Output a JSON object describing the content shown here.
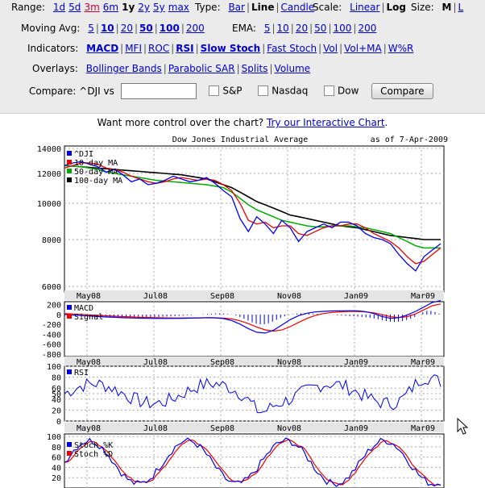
{
  "controls": {
    "range": {
      "label": "Range:",
      "options": [
        "1d",
        "5d",
        "3m",
        "6m",
        "1y",
        "2y",
        "5y",
        "max"
      ],
      "current": "1y",
      "highlight": "3m"
    },
    "type": {
      "label": "Type:",
      "options": [
        "Bar",
        "Line",
        "Candle"
      ],
      "current": "Line"
    },
    "scale": {
      "label": "Scale:",
      "options": [
        "Linear",
        "Log"
      ],
      "current": "Log"
    },
    "size": {
      "label": "Size:",
      "options": [
        "M",
        "L"
      ],
      "current": "M"
    },
    "moving_avg": {
      "label": "Moving Avg:",
      "options": [
        "5",
        "10",
        "20",
        "50",
        "100",
        "200"
      ],
      "bold": [
        "10",
        "50",
        "100"
      ]
    },
    "ema": {
      "label": "EMA:",
      "options": [
        "5",
        "10",
        "20",
        "50",
        "100",
        "200"
      ]
    },
    "indicators": {
      "label": "Indicators:",
      "options": [
        "MACD",
        "MFI",
        "ROC",
        "RSI",
        "Slow Stoch",
        "Fast Stoch",
        "Vol",
        "Vol+MA",
        "W%R"
      ],
      "bold": [
        "MACD",
        "RSI",
        "Slow Stoch"
      ]
    },
    "overlays": {
      "label": "Overlays:",
      "options": [
        "Bollinger Bands",
        "Parabolic SAR",
        "Splits",
        "Volume"
      ]
    },
    "compare": {
      "label": "Compare: ^DJI vs",
      "input_value": "",
      "checkboxes": [
        "S&P",
        "Nasdaq",
        "Dow"
      ],
      "button": "Compare"
    }
  },
  "promo": {
    "text": "Want more control over the chart?",
    "link": "Try our Interactive Chart",
    "suffix": "."
  },
  "chart_data": {
    "type": "line",
    "title": "Dow Jones Industrial Average",
    "date_label": "as of  7-Apr-2009",
    "x_labels": [
      "May08",
      "Jul08",
      "Sep08",
      "Nov08",
      "Jan09",
      "Mar09"
    ],
    "price": {
      "yticks": [
        14000,
        12000,
        10000,
        8000,
        6000
      ],
      "legend": [
        {
          "name": "^DJI",
          "color": "#0000ee"
        },
        {
          "name": "10-day MA",
          "color": "#ee0000"
        },
        {
          "name": "50-day MA",
          "color": "#00aa00"
        },
        {
          "name": "100-day MA",
          "color": "#000000"
        }
      ],
      "dji": [
        12600,
        12800,
        12900,
        12700,
        12500,
        12100,
        12300,
        11900,
        11400,
        11600,
        11200,
        11300,
        11500,
        11800,
        11600,
        11400,
        11500,
        11700,
        11300,
        10800,
        10400,
        9100,
        8400,
        9200,
        8800,
        8300,
        9000,
        8600,
        7900,
        8400,
        8600,
        8800,
        8600,
        8900,
        8900,
        8700,
        8300,
        8100,
        8000,
        7800,
        7300,
        6900,
        6600,
        7200,
        7500,
        7800
      ],
      "ma10": [
        12400,
        12600,
        12800,
        12800,
        12700,
        12400,
        12300,
        12100,
        11800,
        11600,
        11400,
        11300,
        11400,
        11600,
        11700,
        11600,
        11500,
        11600,
        11500,
        11200,
        10800,
        10000,
        9000,
        8800,
        8900,
        8600,
        8700,
        8700,
        8300,
        8200,
        8400,
        8600,
        8700,
        8700,
        8800,
        8800,
        8600,
        8300,
        8100,
        7900,
        7600,
        7200,
        6900,
        7000,
        7300,
        7600
      ],
      "ma50": [
        12600,
        12550,
        12500,
        12400,
        12300,
        12100,
        12000,
        11900,
        11800,
        11700,
        11600,
        11500,
        11450,
        11400,
        11350,
        11300,
        11250,
        11200,
        11100,
        11000,
        10700,
        10300,
        9900,
        9600,
        9400,
        9200,
        9000,
        8900,
        8800,
        8700,
        8650,
        8650,
        8700,
        8700,
        8700,
        8650,
        8600,
        8500,
        8400,
        8300,
        8100,
        7900,
        7700,
        7600,
        7600,
        7600
      ],
      "ma100": [
        12600,
        12550,
        12500,
        12450,
        12400,
        12350,
        12300,
        12250,
        12200,
        12150,
        12100,
        12050,
        12000,
        11950,
        11900,
        11800,
        11700,
        11600,
        11400,
        11200,
        11000,
        10700,
        10400,
        10100,
        9900,
        9700,
        9500,
        9300,
        9200,
        9100,
        9000,
        8900,
        8800,
        8700,
        8650,
        8600,
        8500,
        8400,
        8300,
        8200,
        8150,
        8100,
        8050,
        8000,
        8000,
        8000
      ]
    },
    "macd": {
      "yticks": [
        "200",
        "0",
        "-200",
        "-400",
        "-600",
        "-800"
      ],
      "legend": [
        {
          "name": "MACD",
          "color": "#0000ee"
        },
        {
          "name": "Signal",
          "color": "#ee0000"
        }
      ]
    },
    "rsi": {
      "yticks": [
        "100",
        "80",
        "60",
        "50",
        "40",
        "20",
        "0"
      ],
      "legend": [
        {
          "name": "RSI",
          "color": "#0000ee"
        }
      ]
    },
    "stoch": {
      "yticks": [
        "100",
        "80",
        "60",
        "40",
        "20"
      ],
      "legend": [
        {
          "name": "Stoch %K",
          "color": "#0000ee"
        },
        {
          "name": "Stoch %D",
          "color": "#ee0000"
        }
      ]
    }
  }
}
